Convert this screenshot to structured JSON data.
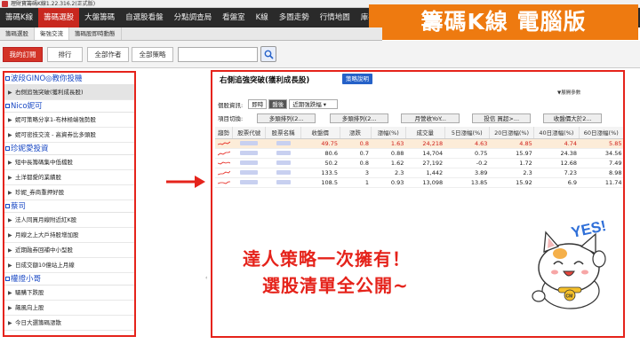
{
  "window": {
    "title": "理財寶籌碼K線1.22.316.2(正式版)"
  },
  "menu": [
    "籌碼K線",
    "籌碼選股",
    "大盤籌碼",
    "自選股看盤",
    "分點調查局",
    "看盤室",
    "K線",
    "多圖走勢",
    "行情地圖",
    "庫存分析"
  ],
  "promo_banner": "籌碼K線 電腦版",
  "subtabs": [
    "籌碼選股",
    "衛強交流",
    "籌碼股即時動態"
  ],
  "toolbar": {
    "my_subs": "我的訂閱",
    "rank": "排行",
    "all_works": "全部作者",
    "all_strategies": "全部策略"
  },
  "left": {
    "groups": [
      {
        "name": "波段GINO◎教你投機",
        "items": [
          "右側追強突破(獲利成長股)"
        ]
      },
      {
        "name": "Nico妮可",
        "items": [
          "妮可策略分享1-布林極端強勢股",
          "妮可密技交流 - 高資券比多頭股"
        ]
      },
      {
        "name": "珍妮愛投資",
        "items": [
          "短中長籌碼集中低檔股",
          "土洋都愛的業績股",
          "珍妮_券商重押好股"
        ]
      },
      {
        "name": "蔡司",
        "items": [
          "法人同買月線附近紅K股",
          "月線之上大戶持股增加股",
          "近期融券回補中小型股",
          "日成交額10億站上月線"
        ]
      },
      {
        "name": "權證小哥",
        "items": [
          "驅購下跌股",
          "飆風向上股",
          "今日大選籌碼漲散"
        ]
      }
    ]
  },
  "right": {
    "title": "右側追強突破(獲利成長股)",
    "strategy_button": "策略說明",
    "top_right": "▼展開參數",
    "filter_label": "個股資訊:",
    "filter_options": [
      "即時",
      "盤後"
    ],
    "filter_dropdown": "近期強跌幅",
    "toggle_label": "項目切換:",
    "toggles": [
      "多頭排列(2...",
      "多頭排列(2...",
      "月營收YoY...",
      "投信 買超>...",
      "收盤價大於2..."
    ],
    "columns": [
      "趨勢",
      "股票代號",
      "股票名稱",
      "收盤價",
      "漲跌",
      "漲幅(%)",
      "成交量",
      "5日漲幅(%)",
      "20日漲幅(%)",
      "40日漲幅(%)",
      "60日漲幅(%)"
    ],
    "rows": [
      [
        "49.75",
        "0.8",
        "1.63",
        "24,218",
        "4.63",
        "4.85",
        "4.74",
        "5.85"
      ],
      [
        "80.6",
        "0.7",
        "0.88",
        "14,704",
        "0.75",
        "15.97",
        "24.38",
        "34.56"
      ],
      [
        "50.2",
        "0.8",
        "1.62",
        "27,192",
        "-0.2",
        "1.72",
        "12.68",
        "7.49"
      ],
      [
        "133.5",
        "3",
        "2.3",
        "1,442",
        "3.89",
        "2.3",
        "7.23",
        "8.98"
      ],
      [
        "108.5",
        "1",
        "0.93",
        "13,098",
        "13.85",
        "15.92",
        "6.9",
        "11.74"
      ]
    ]
  },
  "promo_text": {
    "line1": "達人策略一次擁有！",
    "line2": "選股清單全公開~"
  },
  "mascot": {
    "yes": "YES!",
    "badge": "CM"
  },
  "colors": {
    "accent": "#e5231b",
    "menu_bg": "#2a2a2a",
    "banner": "#ee7a10",
    "button_blue": "#2561c8"
  }
}
